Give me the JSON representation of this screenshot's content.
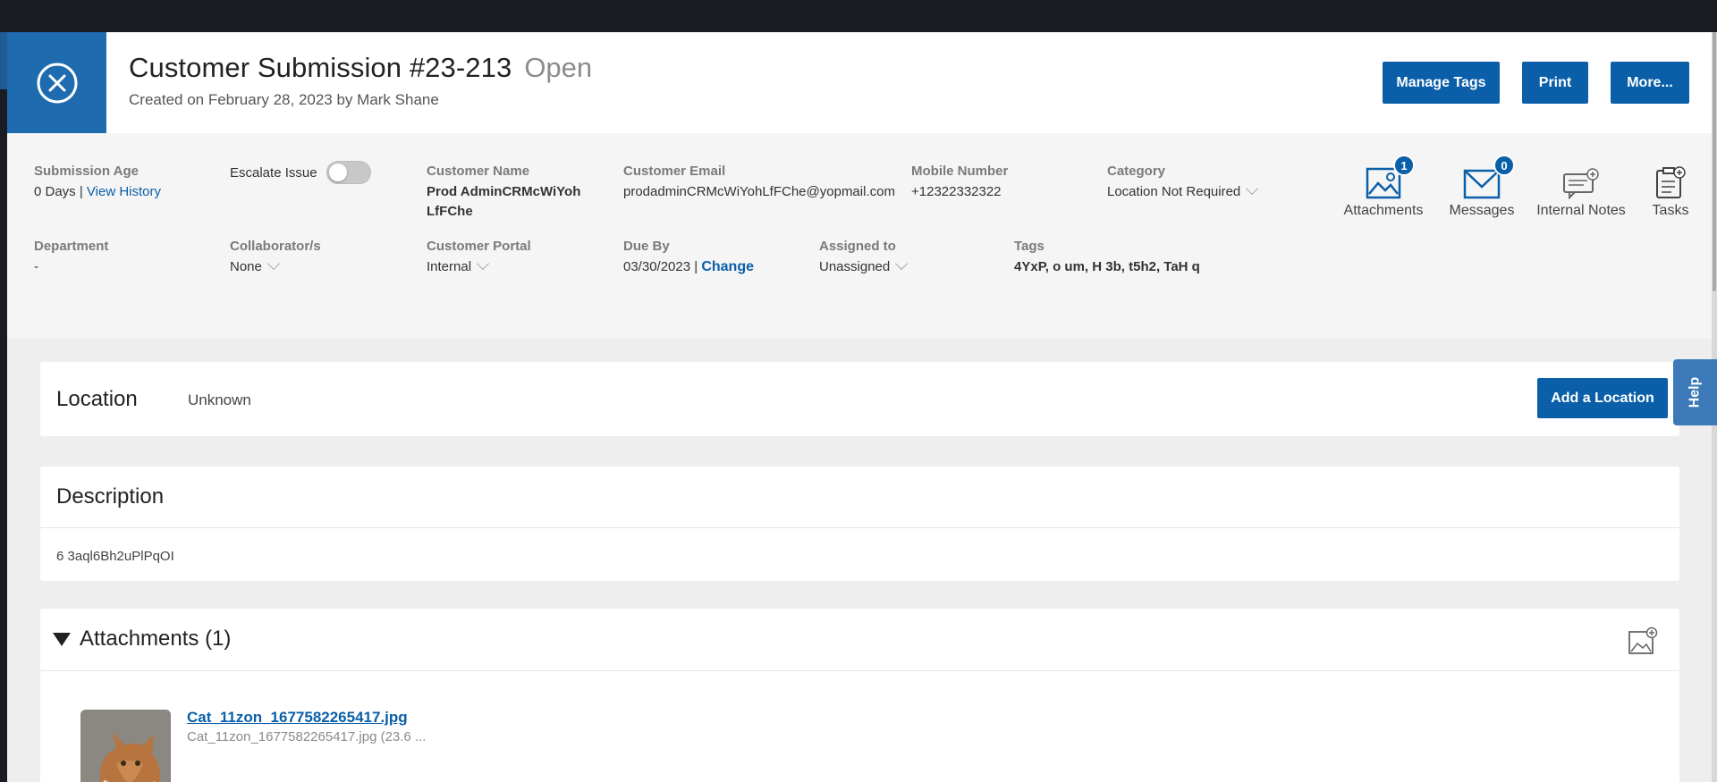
{
  "header": {
    "title": "Customer Submission #23-213",
    "status": "Open",
    "subtitle": "Created on February 28, 2023 by Mark Shane",
    "buttons": {
      "manage_tags": "Manage Tags",
      "print": "Print",
      "more": "More..."
    }
  },
  "meta": {
    "submission_age": {
      "label": "Submission Age",
      "value": "0 Days |",
      "link": "View History"
    },
    "escalate": {
      "label": "Escalate Issue",
      "on": false
    },
    "customer_name": {
      "label": "Customer Name",
      "value": "Prod AdminCRMcWiYoh LfFChe"
    },
    "customer_email": {
      "label": "Customer Email",
      "value": "prodadminCRMcWiYohLfFChe@yopmail.com"
    },
    "mobile": {
      "label": "Mobile Number",
      "value": "+12322332322"
    },
    "category": {
      "label": "Category",
      "value": "Location Not Required"
    },
    "department": {
      "label": "Department",
      "value": "-"
    },
    "collaborators": {
      "label": "Collaborator/s",
      "value": "None"
    },
    "portal": {
      "label": "Customer Portal",
      "value": "Internal"
    },
    "due_by": {
      "label": "Due By",
      "value": "03/30/2023 |",
      "link": "Change"
    },
    "assigned": {
      "label": "Assigned to",
      "value": "Unassigned"
    },
    "tags": {
      "label": "Tags",
      "value": "4YxP, o um, H 3b, t5h2, TaH q"
    }
  },
  "tools": {
    "attachments": {
      "label": "Attachments",
      "count": "1"
    },
    "messages": {
      "label": "Messages",
      "count": "0"
    },
    "internal_notes": {
      "label": "Internal Notes"
    },
    "tasks": {
      "label": "Tasks"
    }
  },
  "location": {
    "title": "Location",
    "value": "Unknown",
    "button": "Add a Location"
  },
  "description": {
    "title": "Description",
    "text": "6 3aql6Bh2uPlPqOI"
  },
  "attachments": {
    "title": "Attachments (1)",
    "files": [
      {
        "name": "Cat_11zon_1677582265417.jpg",
        "meta": "Cat_11zon_1677582265417.jpg (23.6 ..."
      }
    ]
  },
  "help_tab": "Help",
  "colors": {
    "primary": "#0a5fa8",
    "close_block": "#1e6bb0",
    "panel_bg": "#eeeeee"
  }
}
